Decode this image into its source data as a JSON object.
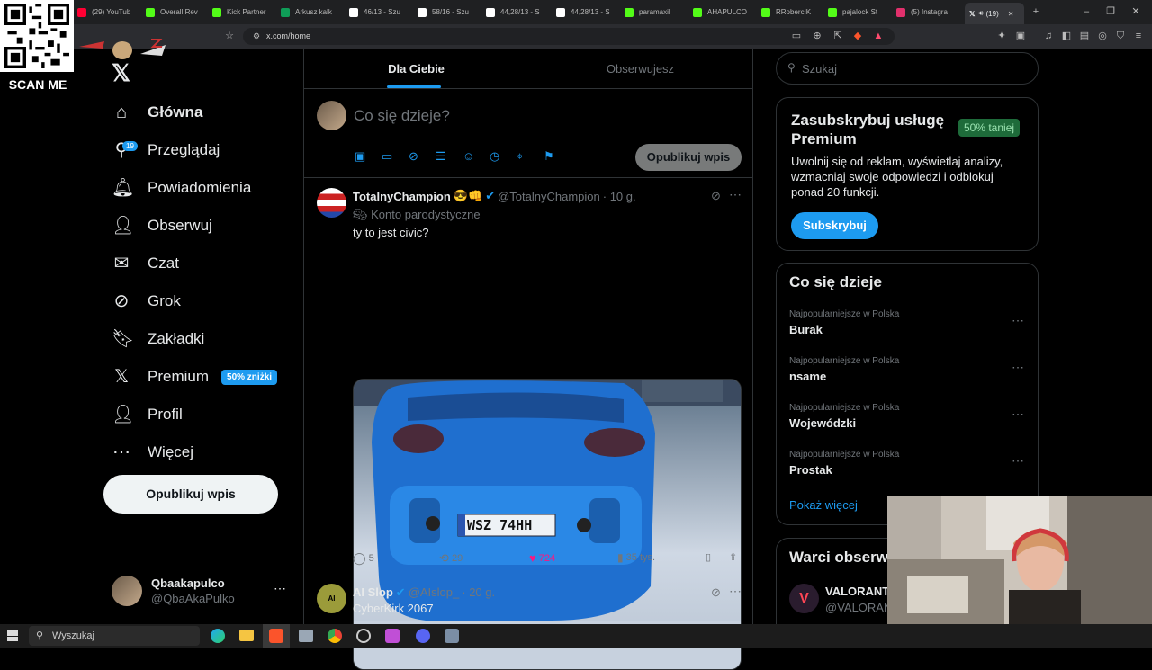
{
  "browser": {
    "tabs": [
      {
        "label": "(29) YouTub",
        "color": "#ff0033",
        "icon": "youtube-icon"
      },
      {
        "label": "Overall Rev",
        "color": "#53fc18",
        "icon": "kick-icon"
      },
      {
        "label": "Kick Partner",
        "color": "#53fc18",
        "icon": "kick-icon"
      },
      {
        "label": "Arkusz kalk",
        "color": "#0f9d58",
        "icon": "sheets-icon"
      },
      {
        "label": "46/13 - Szu",
        "color": "#ffffff",
        "icon": "globe-icon"
      },
      {
        "label": "58/16 - Szu",
        "color": "#ffffff",
        "icon": "globe-icon"
      },
      {
        "label": "44,28/13 - S",
        "color": "#ffffff",
        "icon": "globe-icon"
      },
      {
        "label": "44,28/13 - S",
        "color": "#ffffff",
        "icon": "globe-icon"
      },
      {
        "label": "paramaxil",
        "color": "#53fc18",
        "icon": "kick-icon"
      },
      {
        "label": "AHAPULCO",
        "color": "#53fc18",
        "icon": "kick-icon"
      },
      {
        "label": "RRobercIK",
        "color": "#53fc18",
        "icon": "kick-icon"
      },
      {
        "label": "pajalock St",
        "color": "#53fc18",
        "icon": "kick-icon"
      },
      {
        "label": "(5) Instagra",
        "color": "#e1306c",
        "icon": "instagram-icon"
      }
    ],
    "active_tab": "(19)",
    "url": "x.com/home"
  },
  "overlay": {
    "scan_me": "SCAN ME"
  },
  "nav": {
    "items": [
      {
        "label": "Główna",
        "icon": "home-icon",
        "glyph": "⌂"
      },
      {
        "label": "Przeglądaj",
        "icon": "search-icon",
        "glyph": "⚲"
      },
      {
        "label": "Powiadomienia",
        "icon": "bell-icon",
        "glyph": "🔔︎",
        "badge": "19"
      },
      {
        "label": "Obserwuj",
        "icon": "follow-icon",
        "glyph": "👤︎"
      },
      {
        "label": "Czat",
        "icon": "mail-icon",
        "glyph": "✉"
      },
      {
        "label": "Grok",
        "icon": "grok-icon",
        "glyph": "⊘"
      },
      {
        "label": "Zakładki",
        "icon": "bookmark-icon",
        "glyph": "🔖︎"
      },
      {
        "label": "Premium",
        "icon": "x-icon",
        "glyph": "𝕏",
        "pill": "50% zniżki"
      },
      {
        "label": "Profil",
        "icon": "profile-icon",
        "glyph": "👤︎"
      },
      {
        "label": "Więcej",
        "icon": "more-icon",
        "glyph": "⋯"
      }
    ],
    "post_button": "Opublikuj wpis"
  },
  "account": {
    "name": "Qbaakapulco",
    "handle": "@QbaAkaPulko"
  },
  "feed": {
    "tabs": [
      "Dla Ciebie",
      "Obserwujesz"
    ],
    "compose": {
      "placeholder": "Co się dzieje?",
      "button": "Opublikuj wpis"
    },
    "posts": [
      {
        "name": "TotalnyChampion",
        "emoji": "😎👊",
        "handle": "@TotalnyChampion",
        "time": "· 10 g.",
        "label": "Konto parodystyczne",
        "text": "ty to jest civic?",
        "plate": "WSZ 74HH",
        "replies": "5",
        "reposts": "29",
        "likes": "724",
        "views": "35 tys."
      },
      {
        "name": "AI Slop",
        "handle": "@AIslop_",
        "time": "· 20 g.",
        "text": "CyberKirk 2067"
      }
    ]
  },
  "search": {
    "placeholder": "Szukaj"
  },
  "premium": {
    "title": "Zasubskrybuj usługę Premium",
    "discount": "50% taniej",
    "text": "Uwolnij się od reklam, wyświetlaj analizy, wzmacniaj swoje odpowiedzi i odblokuj ponad 20 funkcji.",
    "button": "Subskrybuj"
  },
  "trends": {
    "title": "Co się dzieje",
    "items": [
      {
        "meta": "Najpopularniejsze w Polska",
        "name": "Burak"
      },
      {
        "meta": "Najpopularniejsze w Polska",
        "name": "nsame"
      },
      {
        "meta": "Najpopularniejsze w Polska",
        "name": "Wojewódzki"
      },
      {
        "meta": "Najpopularniejsze w Polska",
        "name": "Prostak"
      }
    ],
    "more": "Pokaż więcej"
  },
  "who_to_follow": {
    "title": "Warci obserw",
    "name": "VALORANT",
    "handle": "@VALORANT"
  },
  "taskbar": {
    "search": "Wyszukaj"
  },
  "colors": {
    "accent": "#1d9bf0",
    "like": "#f91880"
  }
}
